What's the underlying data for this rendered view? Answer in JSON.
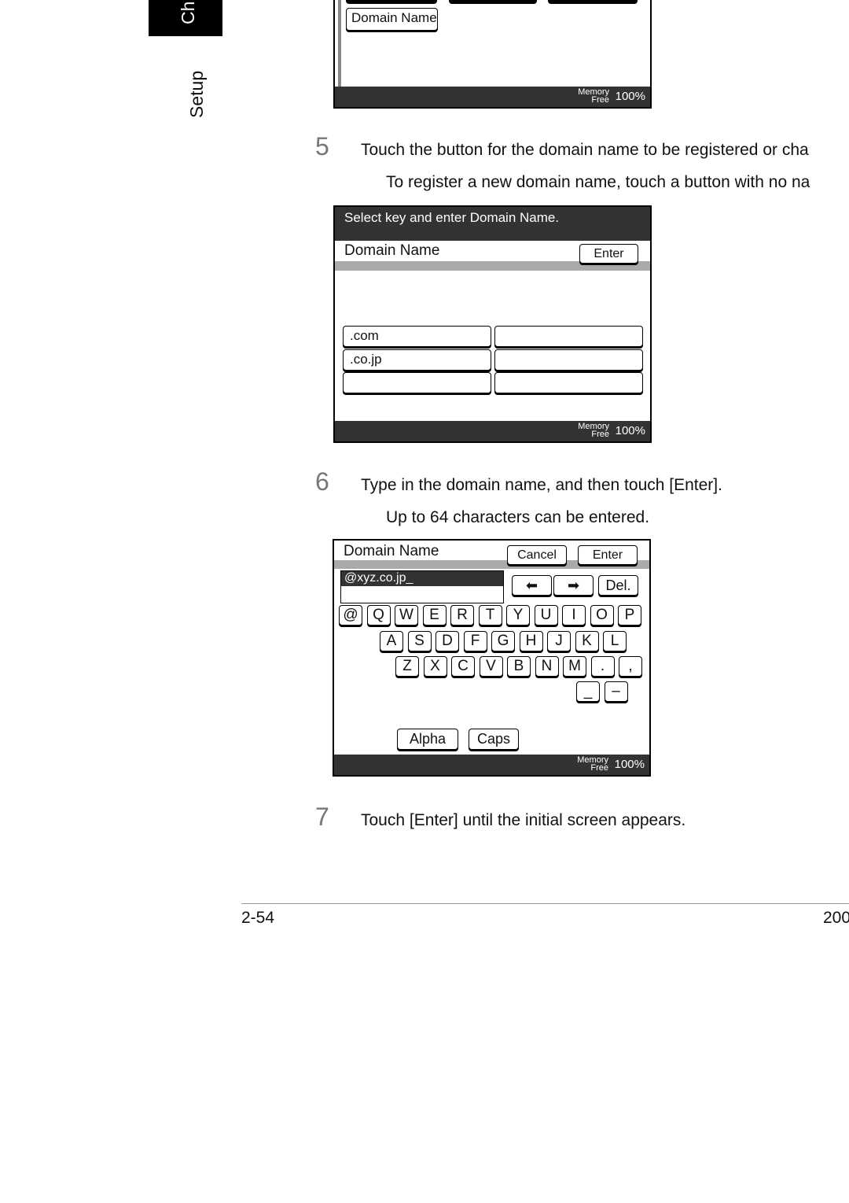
{
  "sidebar": {
    "chapter_tab": "Ch",
    "section": "Setup"
  },
  "screen1": {
    "domain_button": "Domain Name",
    "memory": "Memory",
    "free": "Free",
    "percent": "100%"
  },
  "step5": {
    "number": "5",
    "text": "Touch the button for the domain name to be registered or cha",
    "sub": "To register a new domain name, touch a button with no na"
  },
  "screen2": {
    "header": "Select key and enter Domain Name.",
    "title": "Domain Name",
    "enter": "Enter",
    "buttons": [
      ".com",
      "",
      ".co.jp",
      "",
      "",
      ""
    ],
    "memory": "Memory",
    "free": "Free",
    "percent": "100%"
  },
  "step6": {
    "number": "6",
    "text": "Type in the domain name, and then touch [Enter].",
    "sub": "Up to 64 characters can be entered."
  },
  "screen3": {
    "title": "Domain Name",
    "cancel": "Cancel",
    "enter": "Enter",
    "input_value": "@xyz.co.jp_",
    "left_arrow": "⬅",
    "right_arrow": "➡",
    "delete": "Del.",
    "row1": [
      "@",
      "Q",
      "W",
      "E",
      "R",
      "T",
      "Y",
      "U",
      "I",
      "O",
      "P"
    ],
    "row2": [
      "A",
      "S",
      "D",
      "F",
      "G",
      "H",
      "J",
      "K",
      "L"
    ],
    "row3": [
      "Z",
      "X",
      "C",
      "V",
      "B",
      "N",
      "M",
      ".",
      ","
    ],
    "row4": [
      "_",
      "–"
    ],
    "alpha": "Alpha",
    "caps": "Caps",
    "memory": "Memory",
    "free": "Free",
    "percent": "100%"
  },
  "step7": {
    "number": "7",
    "text": "Touch [Enter] until the initial screen appears."
  },
  "footer": {
    "page": "2-54",
    "right": "200"
  }
}
